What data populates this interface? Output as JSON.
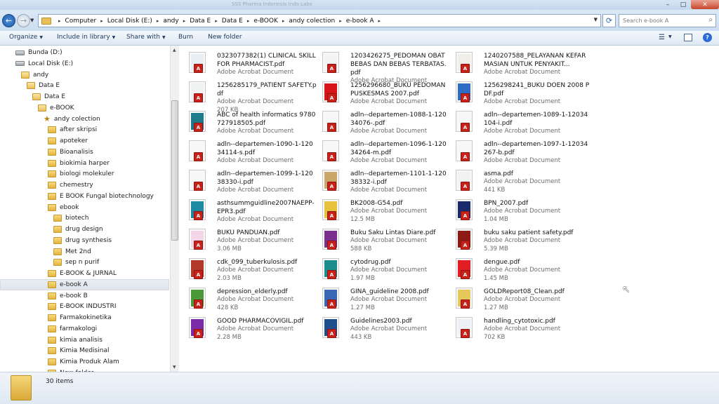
{
  "window": {
    "title": "SSS Pharma Indonesia Indo Labs",
    "controls": {
      "minimize": "–",
      "maximize": "□",
      "close": "✕"
    }
  },
  "address": {
    "back_icon": "←",
    "forward_icon": "→",
    "history_icon": "▼",
    "refresh_icon": "⟳",
    "dropdown_icon": "▼",
    "separator": "▸",
    "crumbs": [
      "Computer",
      "Local Disk (E:)",
      "andy",
      "Data E",
      "Data E",
      "e-BOOK",
      "andy colection",
      "e-book A"
    ]
  },
  "search": {
    "placeholder": "Search e-book A",
    "icon": "search-icon",
    "glyph": "⌕"
  },
  "toolbar": {
    "organize": "Organize",
    "include": "Include in library",
    "share": "Share with",
    "burn": "Burn",
    "new_folder": "New folder",
    "dropdown_glyph": "▼",
    "view_glyph": "☰",
    "help_glyph": "?"
  },
  "nav": {
    "scroll_up": "▲",
    "scroll_down": "▼",
    "items": [
      {
        "label": "Bunda (D:)",
        "kind": "drive",
        "level": 1
      },
      {
        "label": "Local Disk (E:)",
        "kind": "drive",
        "level": 1
      },
      {
        "label": "andy",
        "kind": "folder",
        "level": 2
      },
      {
        "label": "Data E",
        "kind": "folder",
        "level": 3
      },
      {
        "label": "Data E",
        "kind": "folder",
        "level": 4
      },
      {
        "label": "e-BOOK",
        "kind": "folder",
        "level": 5
      },
      {
        "label": "andy colection",
        "kind": "library",
        "level": 6
      },
      {
        "label": "after skripsi",
        "kind": "folder",
        "level": 7
      },
      {
        "label": "apoteker",
        "kind": "folder",
        "level": 7
      },
      {
        "label": "Bioanalisis",
        "kind": "folder",
        "level": 7
      },
      {
        "label": "biokimia harper",
        "kind": "folder",
        "level": 7
      },
      {
        "label": "biologi molekuler",
        "kind": "folder",
        "level": 7
      },
      {
        "label": "chemestry",
        "kind": "folder",
        "level": 7
      },
      {
        "label": "E BOOK Fungal biotechnology",
        "kind": "folder",
        "level": 7
      },
      {
        "label": "ebook",
        "kind": "folder",
        "level": 7
      },
      {
        "label": "biotech",
        "kind": "folder",
        "level": 8
      },
      {
        "label": "drug design",
        "kind": "folder",
        "level": 8
      },
      {
        "label": "drug synthesis",
        "kind": "folder",
        "level": 8
      },
      {
        "label": "Met 2nd",
        "kind": "folder",
        "level": 8
      },
      {
        "label": "sep n purif",
        "kind": "folder",
        "level": 8
      },
      {
        "label": "E-BOOK & JURNAL",
        "kind": "folder",
        "level": 7
      },
      {
        "label": "e-book A",
        "kind": "folder",
        "level": 7,
        "selected": true
      },
      {
        "label": "e-book B",
        "kind": "folder",
        "level": 7
      },
      {
        "label": "E-BOOK INDUSTRI",
        "kind": "folder",
        "level": 7
      },
      {
        "label": "Farmakokinetika",
        "kind": "folder",
        "level": 7
      },
      {
        "label": "farmakologi",
        "kind": "folder",
        "level": 7
      },
      {
        "label": "kimia analisis",
        "kind": "folder",
        "level": 7
      },
      {
        "label": "Kimia Medisinal",
        "kind": "folder",
        "level": 7
      },
      {
        "label": "Kimia Produk Alam",
        "kind": "folder",
        "level": 7
      },
      {
        "label": "New folder",
        "kind": "folder",
        "level": 7
      }
    ]
  },
  "files": [
    {
      "name": "0323077382(1) CLINICAL SKILL FOR PHARMACIST.pdf",
      "type": "Adobe Acrobat Document",
      "size": "",
      "cover": "#e9eef5"
    },
    {
      "name": "1203426275_PEDOMAN OBAT BEBAS DAN BEBAS TERBATAS.pdf",
      "type": "Adobe Acrobat Document",
      "size": "",
      "cover": "#f4f4f4"
    },
    {
      "name": "1240207588_PELAYANAN KEFARMASIAN UNTUK PENYAKIT...",
      "type": "Adobe Acrobat Document",
      "size": "",
      "cover": "#f1ede8"
    },
    {
      "name": "1256285179_PATIENT SAFETY.pdf",
      "type": "Adobe Acrobat Document",
      "size": "207 KB",
      "cover": "#f0f3f1"
    },
    {
      "name": "1256296680_BUKU PEDOMAN PUSKESMAS 2007.pdf",
      "type": "Adobe Acrobat Document",
      "size": "",
      "cover": "#d8141b"
    },
    {
      "name": "1256298241_BUKU DOEN 2008 PDF.pdf",
      "type": "Adobe Acrobat Document",
      "size": "",
      "cover": "#2f6cc4"
    },
    {
      "name": "ABC of health informatics 9780727918505.pdf",
      "type": "Adobe Acrobat Document",
      "size": "",
      "cover": "#1f7a8c"
    },
    {
      "name": "adln--departemen-1088-1-12034076-.pdf",
      "type": "Adobe Acrobat Document",
      "size": "",
      "cover": "#f7f7f7"
    },
    {
      "name": "adln--departemen-1089-1-12034104-i.pdf",
      "type": "Adobe Acrobat Document",
      "size": "",
      "cover": "#f7f7f7"
    },
    {
      "name": "adln--departemen-1090-1-12034114-s.pdf",
      "type": "Adobe Acrobat Document",
      "size": "",
      "cover": "#f7f7f7"
    },
    {
      "name": "adln--departemen-1096-1-12034264-m.pdf",
      "type": "Adobe Acrobat Document",
      "size": "",
      "cover": "#f7f7f7"
    },
    {
      "name": "adln--departemen-1097-1-12034267-b.pdf",
      "type": "Adobe Acrobat Document",
      "size": "",
      "cover": "#f7f7f7"
    },
    {
      "name": "adln--departemen-1099-1-12038330-i.pdf",
      "type": "Adobe Acrobat Document",
      "size": "",
      "cover": "#f7f7f7"
    },
    {
      "name": "adln--departemen-1101-1-12038332-i.pdf",
      "type": "Adobe Acrobat Document",
      "size": "",
      "cover": "#c9a86a"
    },
    {
      "name": "asma.pdf",
      "type": "Adobe Acrobat Document",
      "size": "441 KB",
      "cover": "#f2f2f2"
    },
    {
      "name": "asthsummguidline2007NAEPP-EPR3.pdf",
      "type": "Adobe Acrobat Document",
      "size": "",
      "cover": "#1d8aa1"
    },
    {
      "name": "BK2008-G54.pdf",
      "type": "Adobe Acrobat Document",
      "size": "12.5 MB",
      "cover": "#e6c23a"
    },
    {
      "name": "BPN_2007.pdf",
      "type": "Adobe Acrobat Document",
      "size": "1.04 MB",
      "cover": "#1a2a6c"
    },
    {
      "name": "BUKU PANDUAN.pdf",
      "type": "Adobe Acrobat Document",
      "size": "3.06 MB",
      "cover": "#f3d6e8"
    },
    {
      "name": "Buku Saku Lintas Diare.pdf",
      "type": "Adobe Acrobat Document",
      "size": "588 KB",
      "cover": "#7a2f8f"
    },
    {
      "name": "buku saku patient safety.pdf",
      "type": "Adobe Acrobat Document",
      "size": "5.39 MB",
      "cover": "#8c1c13"
    },
    {
      "name": "cdk_099_tuberkulosis.pdf",
      "type": "Adobe Acrobat Document",
      "size": "2.03 MB",
      "cover": "#b23a2a"
    },
    {
      "name": "cytodrug.pdf",
      "type": "Adobe Acrobat Document",
      "size": "1.97 MB",
      "cover": "#1d8c8c"
    },
    {
      "name": "dengue.pdf",
      "type": "Adobe Acrobat Document",
      "size": "1.45 MB",
      "cover": "#e21d25"
    },
    {
      "name": "depression_elderly.pdf",
      "type": "Adobe Acrobat Document",
      "size": "428 KB",
      "cover": "#4a9a3a"
    },
    {
      "name": "GINA_guideline 2008.pdf",
      "type": "Adobe Acrobat Document",
      "size": "1.27 MB",
      "cover": "#3a67b5"
    },
    {
      "name": "GOLDReport08_Clean.pdf",
      "type": "Adobe Acrobat Document",
      "size": "1.27 MB",
      "cover": "#e6c85a"
    },
    {
      "name": "GOOD PHARMACOVIGIL.pdf",
      "type": "Adobe Acrobat Document",
      "size": "2.28 MB",
      "cover": "#7b2aa8"
    },
    {
      "name": "Guidelines2003.pdf",
      "type": "Adobe Acrobat Document",
      "size": "443 KB",
      "cover": "#1f4e8c"
    },
    {
      "name": "handling_cytotoxic.pdf",
      "type": "Adobe Acrobat Document",
      "size": "702 KB",
      "cover": "#eef0f6"
    }
  ],
  "pdf_badge": "A",
  "status": {
    "count": "30 items"
  },
  "cursor_glyph": "↖"
}
